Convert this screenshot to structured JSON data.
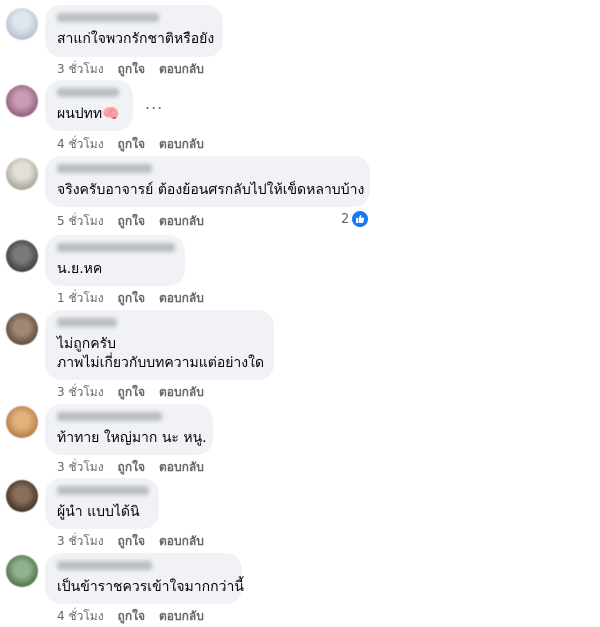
{
  "actions": {
    "like": "ถูกใจ",
    "reply": "ตอบกลับ"
  },
  "comments": [
    {
      "text": "สาแก่ใจพวกรักชาติหรือยัง",
      "time": "3 ชั่วโมง"
    },
    {
      "text": "ผนปทท🧠",
      "time": "4 ชั่วโมง",
      "more": "..."
    },
    {
      "text": "จริงครับอาจารย์ ต้องย้อนศรกลับไปให้เข็ดหลาบบ้าง",
      "time": "5 ชั่วโมง",
      "reactions": "2"
    },
    {
      "text": "น.ย.หค",
      "time": "1 ชั่วโมง"
    },
    {
      "lines": [
        "ไม่ถูกครับ",
        "ภาพไม่เกี่ยวกับบทความแต่อย่างใด"
      ],
      "time": "3 ชั่วโมง"
    },
    {
      "text": "ท้าทาย ใหญ่มาก นะ หนู.",
      "time": "3 ชั่วโมง"
    },
    {
      "text": "ผู้นำ แบบได้นิ",
      "time": "3 ชั่วโมง"
    },
    {
      "text": "เป็นข้าราชควรเข้าใจมากกว่านี้",
      "time": "4 ชั่วโมง"
    }
  ]
}
